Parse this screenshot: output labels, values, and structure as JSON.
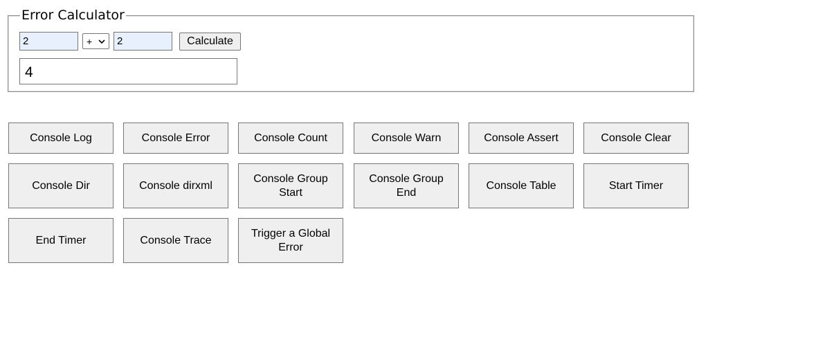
{
  "calculator": {
    "legend": "Error Calculator",
    "operand_a": "2",
    "operator": "+",
    "operand_b": "2",
    "calculate_label": "Calculate",
    "result": "4"
  },
  "buttons": {
    "console_log": "Console Log",
    "console_error": "Console Error",
    "console_count": "Console Count",
    "console_warn": "Console Warn",
    "console_assert": "Console Assert",
    "console_clear": "Console Clear",
    "console_dir": "Console Dir",
    "console_dirxml": "Console dirxml",
    "console_group_start": "Console Group Start",
    "console_group_end": "Console Group End",
    "console_table": "Console Table",
    "start_timer": "Start Timer",
    "end_timer": "End Timer",
    "console_trace": "Console Trace",
    "trigger_global_error": "Trigger a Global Error"
  },
  "icons": {
    "operator_dropdown": "chevron-down-icon"
  }
}
